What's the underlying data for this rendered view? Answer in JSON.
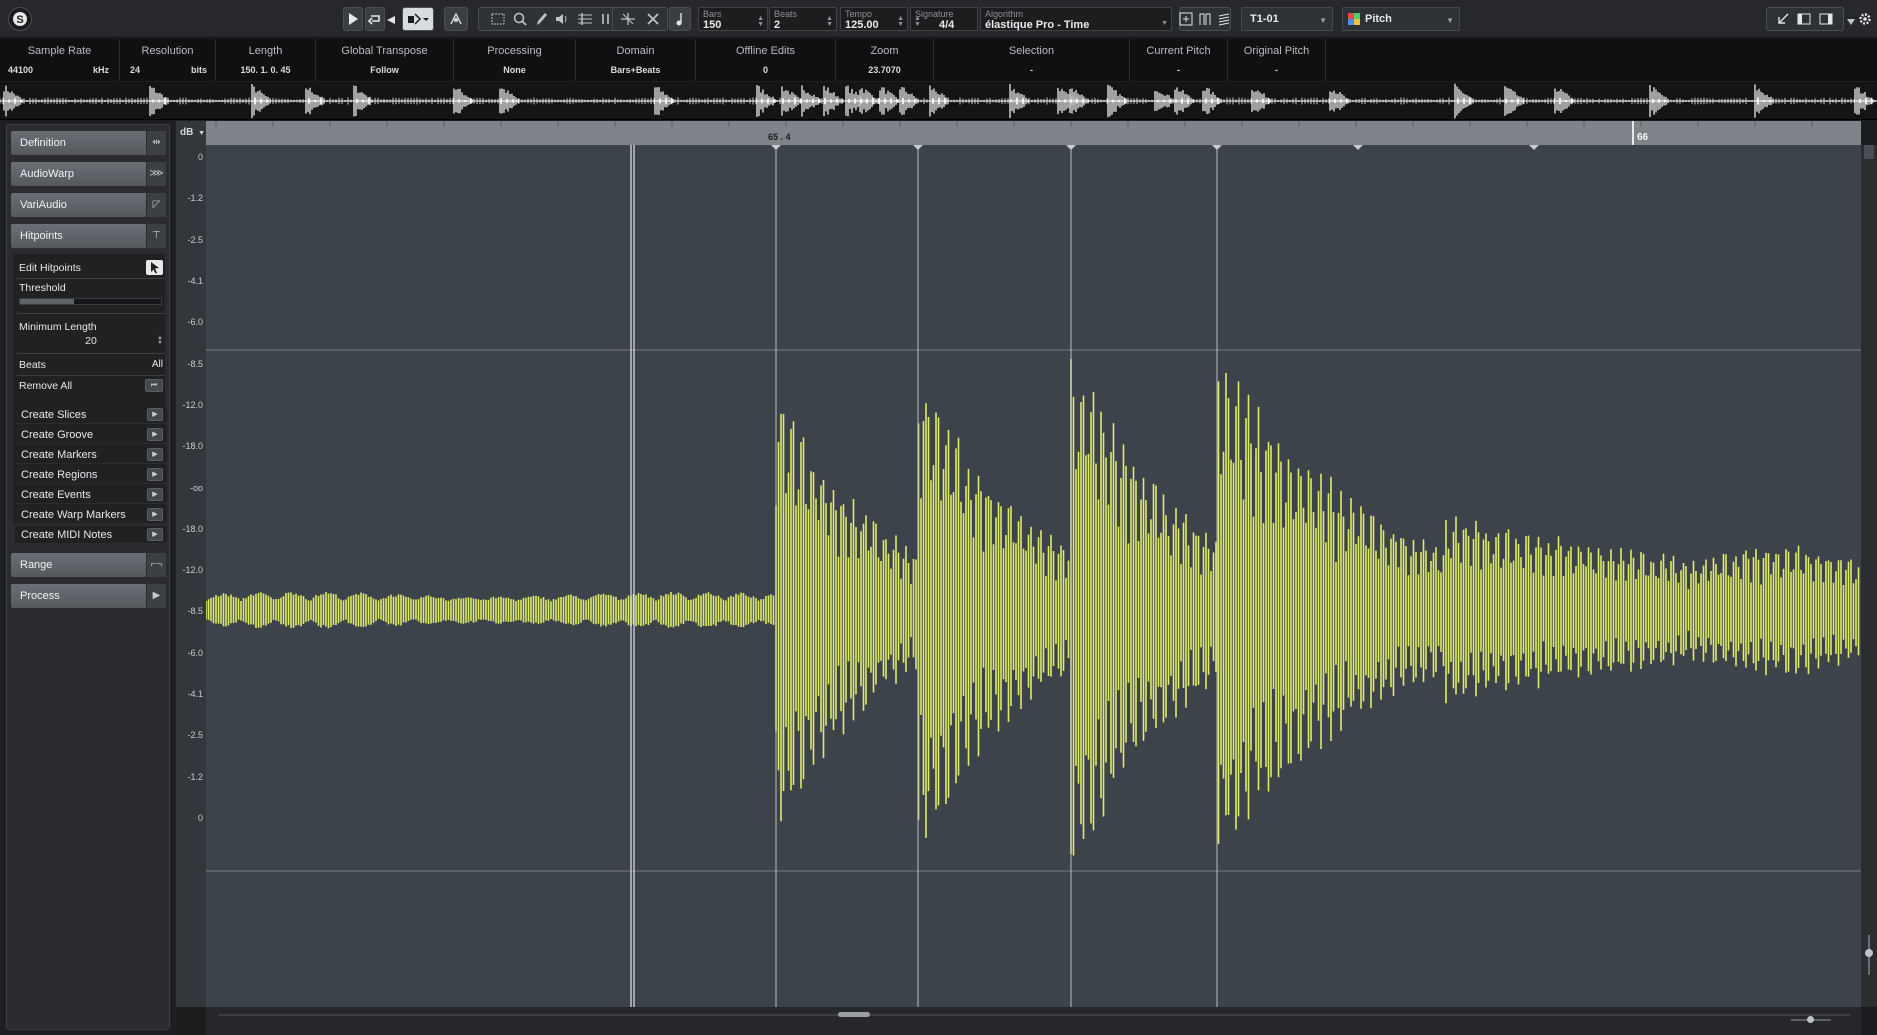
{
  "toolbar": {
    "bars_label": "Bars",
    "bars_value": "150",
    "beats_label": "Beats",
    "beats_value": "2",
    "tempo_label": "Tempo",
    "tempo_value": "125.00",
    "signature_label": "Signature",
    "signature_value": "4/4",
    "algorithm_label": "Algorithm",
    "algorithm_value": "élastique Pro - Time",
    "track_select": "T1-01",
    "pitch_select": "Pitch"
  },
  "infoline": {
    "columns": [
      {
        "header": "Sample Rate",
        "value": "44100",
        "unit": "kHz"
      },
      {
        "header": "Resolution",
        "value": "24",
        "unit": "bits"
      },
      {
        "header": "Length",
        "value": "150. 1. 0. 45"
      },
      {
        "header": "Global Transpose",
        "value": "Follow"
      },
      {
        "header": "Processing",
        "value": "None"
      },
      {
        "header": "Domain",
        "value": "Bars+Beats"
      },
      {
        "header": "Offline Edits",
        "value": "0"
      },
      {
        "header": "Zoom",
        "value": "23.7070"
      },
      {
        "header": "Selection",
        "value": "-"
      },
      {
        "header": "Current Pitch",
        "value": "-"
      },
      {
        "header": "Original Pitch",
        "value": "-"
      }
    ]
  },
  "inspector": {
    "sections": {
      "definition": "Definition",
      "audiowarp": "AudioWarp",
      "variaudio": "VariAudio",
      "hitpoints": "Hitpoints",
      "range": "Range",
      "process": "Process"
    },
    "hitpoints": {
      "edit_label": "Edit Hitpoints",
      "threshold_label": "Threshold",
      "threshold_level": 0.38,
      "min_length_label": "Minimum Length",
      "min_length_value": "20",
      "beats_label": "Beats",
      "beats_value": "All",
      "remove_all_label": "Remove All"
    },
    "actions": [
      "Create Slices",
      "Create Groove",
      "Create Markers",
      "Create Regions",
      "Create Events",
      "Create Warp Markers",
      "Create MIDI Notes"
    ]
  },
  "editor": {
    "db_header": "dB",
    "db_ticks": [
      "0",
      "-1.2",
      "-2.5",
      "-4.1",
      "-6.0",
      "-8.5",
      "-12.0",
      "-18.0",
      "-oo",
      "-18.0",
      "-12.0",
      "-8.5",
      "-6.0",
      "-4.1",
      "-2.5",
      "-1.2",
      "0"
    ],
    "ruler_labels": [
      "65 . 4",
      "66"
    ]
  },
  "colors": {
    "waveform": "#e0eb6b",
    "overview_wave": "#ffffff",
    "wave_background": "#3c434a",
    "ruler": "#7e848a"
  }
}
